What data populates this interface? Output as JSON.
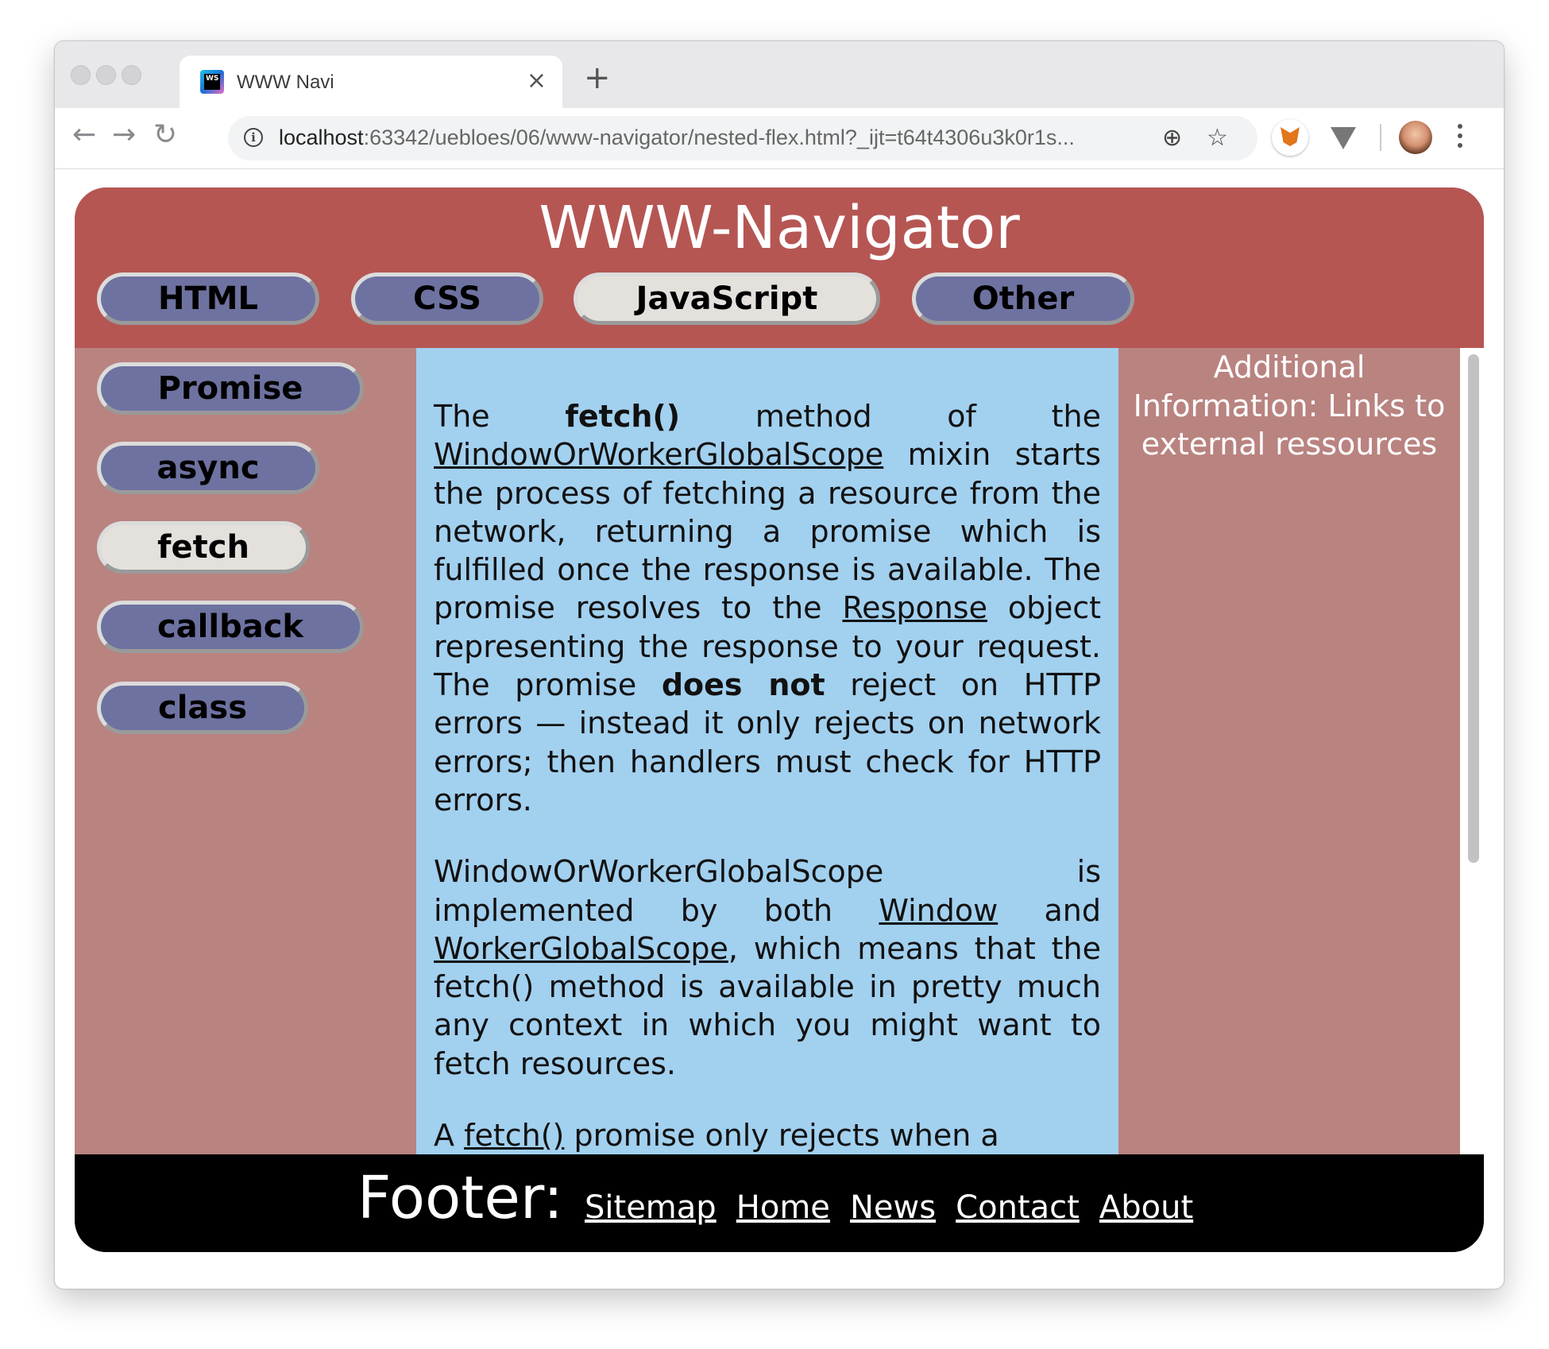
{
  "browser": {
    "tab_title": "WWW Navi",
    "tab_close": "×",
    "new_tab": "+",
    "back": "←",
    "forward": "→",
    "reload": "↻",
    "url_host": "localhost",
    "url_rest": ":63342/uebloes/06/www-navigator/nested-flex.html?_ijt=t64t4306u3k0r1s...",
    "zoom_icon": "⊕",
    "star_icon": "☆",
    "info_icon": "i",
    "favicon_text": "WS"
  },
  "header": {
    "title": "WWW-Navigator",
    "nav": [
      {
        "label": "HTML",
        "active": false
      },
      {
        "label": "CSS",
        "active": false
      },
      {
        "label": "JavaScript",
        "active": true
      },
      {
        "label": "Other",
        "active": false
      }
    ]
  },
  "sidebar": {
    "items": [
      {
        "label": "Promise",
        "active": false
      },
      {
        "label": "async",
        "active": false
      },
      {
        "label": "fetch",
        "active": true
      },
      {
        "label": "callback",
        "active": false
      },
      {
        "label": "class",
        "active": false
      }
    ]
  },
  "main": {
    "p1": {
      "t1": "The ",
      "b1": "fetch()",
      "t2": " method of the ",
      "link1": "WindowOrWorkerGlobalScope",
      "t3": " mixin starts the process of fetching a resource from the network, returning a promise which is fulfilled once the response is available. The promise resolves to the ",
      "link2": "Response",
      "t4": " object representing the response to your request. The promise ",
      "b2": "does not",
      "t5": " reject on HTTP errors — instead it only rejects on network errors; then handlers must check for HTTP errors."
    },
    "p2": {
      "t1": "WindowOrWorkerGlobalScope is implemented by both ",
      "link1": "Window",
      "t2": " and ",
      "link2": "WorkerGlobalScope",
      "t3": ", which means that the fetch() method is available in pretty much any context in which you might want to fetch resources."
    },
    "p3": {
      "t1": "A ",
      "link1": "fetch()",
      "t2": " promise only rejects when a"
    }
  },
  "aside": {
    "title": "Additional Information: Links to external ressources"
  },
  "footer": {
    "title": "Footer:",
    "links": [
      "Sitemap",
      "Home",
      "News",
      "Contact",
      "About"
    ]
  }
}
